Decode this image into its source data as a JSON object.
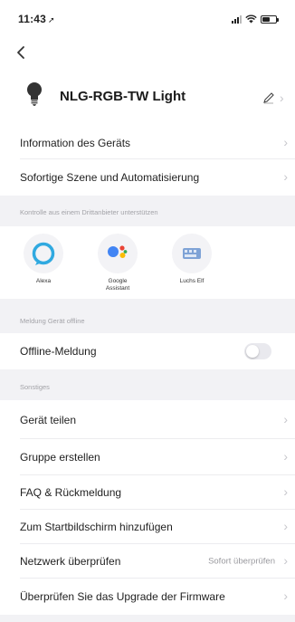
{
  "status_bar": {
    "time": "11:43",
    "location_glyph": "➚"
  },
  "header": {
    "device_name": "NLG-RGB-TW Light"
  },
  "menu_top": [
    {
      "label": "Information des Geräts"
    },
    {
      "label": "Sofortige Szene und Automatisierung"
    }
  ],
  "third_party": {
    "section_title": "Kontrolle aus einem Drittanbieter unterstützen",
    "items": [
      {
        "label": "Alexa",
        "icon": "alexa-icon"
      },
      {
        "label": "Google\nAssistant",
        "icon": "google-assistant-icon"
      },
      {
        "label": "Luchs Elf",
        "icon": "luchs-elf-icon"
      }
    ]
  },
  "offline": {
    "section_title": "Meldung Gerät offline",
    "label": "Offline-Meldung",
    "enabled": false
  },
  "others": {
    "section_title": "Sonstiges",
    "items": [
      {
        "label": "Gerät teilen"
      },
      {
        "label": "Gruppe erstellen"
      },
      {
        "label": "FAQ & Rückmeldung"
      },
      {
        "label": "Zum Startbildschirm hinzufügen"
      },
      {
        "label": "Netzwerk überprüfen",
        "value": "Sofort überprüfen"
      },
      {
        "label": "Überprüfen Sie das Upgrade der Firmware"
      }
    ]
  },
  "colors": {
    "alexa": "#30a9e0",
    "google_blue": "#4285f4",
    "google_red": "#ea4335",
    "google_yellow": "#fbbc05",
    "google_green": "#34a853",
    "luchs": "#7fa3d6"
  }
}
